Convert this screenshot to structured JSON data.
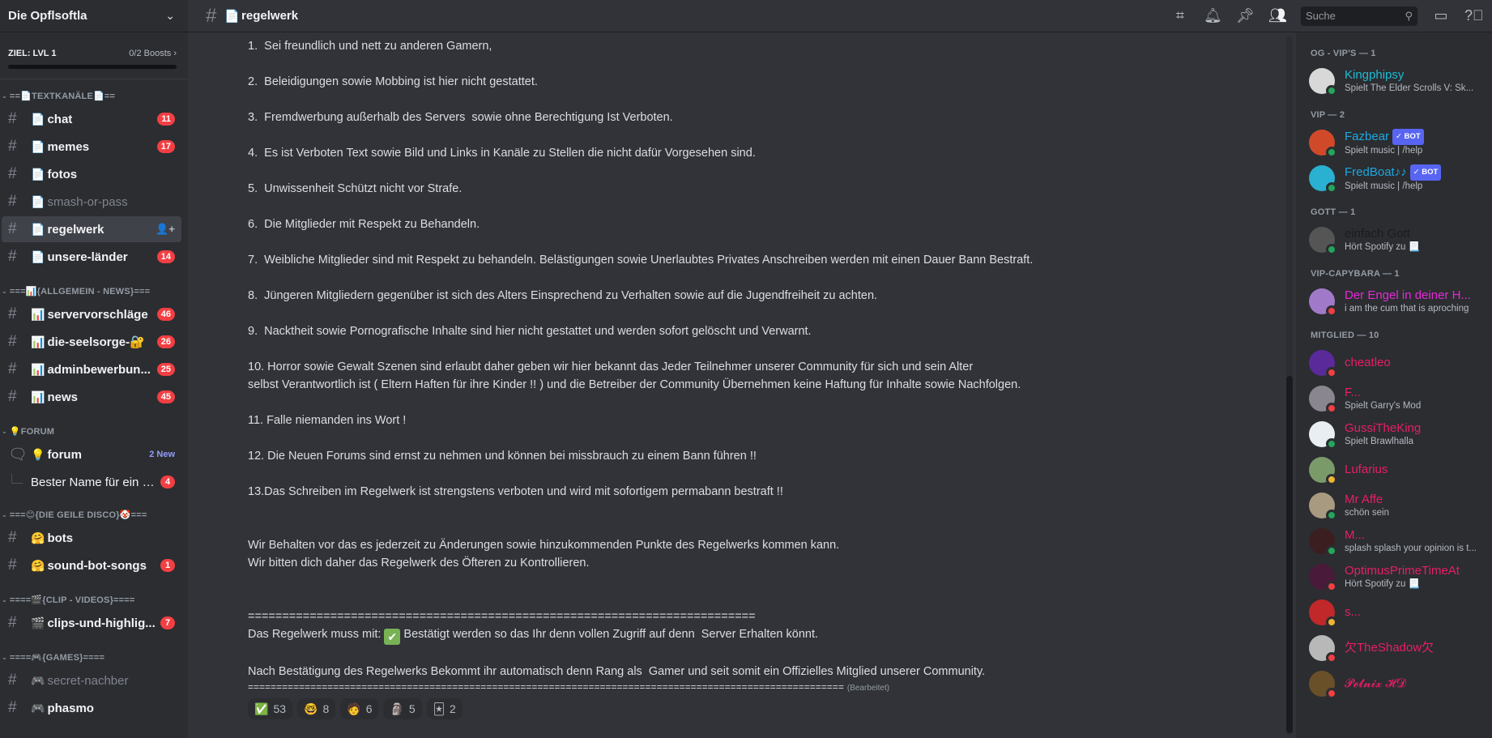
{
  "server": {
    "name": "Die Opflsoftla",
    "boost_goal": "ZIEL: LVL 1",
    "boost_count": "0/2 Boosts",
    "boost_progress": 0
  },
  "sidebar": {
    "categories": [
      {
        "label": "==📄TEXTKANÄLE📄==",
        "channels": [
          {
            "emoji": "📄",
            "name": "chat",
            "badge": "11",
            "muted": false
          },
          {
            "emoji": "📄",
            "name": "memes",
            "badge": "17",
            "muted": false
          },
          {
            "emoji": "📄",
            "name": "fotos",
            "badge": "",
            "muted": false
          },
          {
            "emoji": "📄",
            "name": "smash-or-pass",
            "badge": "",
            "muted": true
          },
          {
            "emoji": "📄",
            "name": "regelwerk",
            "badge": "",
            "muted": false,
            "active": true
          },
          {
            "emoji": "📄",
            "name": "unsere-länder",
            "badge": "14",
            "muted": false
          }
        ]
      },
      {
        "label": "===📊{ALLGEMEIN - NEWS}===",
        "channels": [
          {
            "emoji": "📊",
            "name": "servervorschläge",
            "badge": "46",
            "muted": false
          },
          {
            "emoji": "📊",
            "name": "die-seelsorge-🔐",
            "badge": "26",
            "muted": false
          },
          {
            "emoji": "📊",
            "name": "adminbewerbun...",
            "badge": "25",
            "muted": false
          },
          {
            "emoji": "📊",
            "name": "news",
            "badge": "45",
            "muted": false
          }
        ]
      },
      {
        "label": "💡FORUM",
        "forum": {
          "emoji": "💡",
          "name": "forum",
          "new_label": "2 New"
        },
        "thread": {
          "name": "Bester Name für ein B...",
          "badge": "4"
        }
      },
      {
        "label": "===😊{DIE GEILE DISCO}🤡===",
        "channels": [
          {
            "emoji": "🤗",
            "name": "bots",
            "badge": "",
            "muted": false
          },
          {
            "emoji": "🤗",
            "name": "sound-bot-songs",
            "badge": "1",
            "muted": false
          }
        ]
      },
      {
        "label": "====🎬{CLIP - VIDEOS}====",
        "channels": [
          {
            "emoji": "🎬",
            "name": "clips-und-highlig...",
            "badge": "7",
            "muted": false
          }
        ]
      },
      {
        "label": "====🎮{GAMES}====",
        "channels": [
          {
            "emoji": "🎮",
            "name": "secret-nachber",
            "badge": "",
            "muted": true
          },
          {
            "emoji": "🎮",
            "name": "phasmo",
            "badge": "",
            "muted": false
          }
        ]
      }
    ]
  },
  "header": {
    "channel_emoji": "📄",
    "channel_name": "regelwerk",
    "search_placeholder": "Suche",
    "icons": [
      "threads-icon",
      "bell-icon",
      "pin-icon",
      "members-icon",
      "inbox-icon",
      "help-icon"
    ]
  },
  "message": {
    "lines": [
      "1.  Sei freundlich und nett zu anderen Gamern,",
      "",
      "2.  Beleidigungen sowie Mobbing ist hier nicht gestattet.",
      "",
      "3.  Fremdwerbung außerhalb des Servers  sowie ohne Berechtigung Ist Verboten.",
      "",
      "4.  Es ist Verboten Text sowie Bild und Links in Kanäle zu Stellen die nicht dafür Vorgesehen sind.",
      "",
      "5.  Unwissenheit Schützt nicht vor Strafe.",
      "",
      "6.  Die Mitglieder mit Respekt zu Behandeln.",
      "",
      "7.  Weibliche Mitglieder sind mit Respekt zu behandeln. Belästigungen sowie Unerlaubtes Privates Anschreiben werden mit einen Dauer Bann Bestraft.",
      "",
      "8.  Jüngeren Mitgliedern gegenüber ist sich des Alters Einsprechend zu Verhalten sowie auf die Jugendfreiheit zu achten.",
      "",
      "9.  Nacktheit sowie Pornografische Inhalte sind hier nicht gestattet und werden sofort gelöscht und Verwarnt.",
      "",
      "10. Horror sowie Gewalt Szenen sind erlaubt daher geben wir hier bekannt das Jeder Teilnehmer unserer Community für sich und sein Alter",
      "selbst Verantwortlich ist ( Eltern Haften für ihre Kinder !! ) und die Betreiber der Community Übernehmen keine Haftung für Inhalte sowie Nachfolgen.",
      "",
      "11. Falle niemanden ins Wort !",
      "",
      "12. Die Neuen Forums sind ernst zu nehmen und können bei missbrauch zu einem Bann führen !!",
      "",
      "13.Das Schreiben im Regelwerk ist strengstens verboten und wird mit sofortigem permabann bestraft !!",
      "",
      "",
      "Wir Behalten vor das es jederzeit zu Änderungen sowie hinzukommenden Punkte des Regelwerks kommen kann.",
      "Wir bitten dich daher das Regelwerk des Öfteren zu Kontrollieren.",
      "",
      "",
      "=========================================================================="
    ],
    "confirm_prefix": "Das Regelwerk muss mit: ",
    "confirm_emoji": "✔",
    "confirm_suffix": " Bestätigt werden so das Ihr denn vollen Zugriff auf denn  Server Erhalten könnt.",
    "after_confirm": "Nach Bestätigung des Regelwerks Bekommt ihr automatisch denn Rang als  Gamer und seit somit ein Offizielles Mitglied unserer Community.",
    "final_rule": "=========================================================================================================",
    "edited_label": "(Bearbeitet)",
    "reactions": [
      {
        "emoji": "✅",
        "count": "53"
      },
      {
        "emoji": "🤓",
        "count": "8"
      },
      {
        "emoji": "🧑",
        "count": "6"
      },
      {
        "emoji": "🗿",
        "count": "5"
      },
      {
        "emoji": "🃏",
        "count": "2"
      }
    ]
  },
  "members": {
    "groups": [
      {
        "label": "OG - VIP'S — 1",
        "members": [
          {
            "name": "Kingphipsy",
            "activity": "Spielt The Elder Scrolls V: Sk...",
            "color": "#1abcd4",
            "status": "online",
            "avatar": "#d8d8d8"
          }
        ]
      },
      {
        "label": "VIP — 2",
        "members": [
          {
            "name": "Fazbear",
            "activity": "Spielt music | /help",
            "color": "#1ea8e0",
            "status": "online",
            "bot": "✓ BOT",
            "avatar": "#d04a2a"
          },
          {
            "name": "FredBoat♪♪",
            "activity": "Spielt music | /help",
            "color": "#1ea8e0",
            "status": "online",
            "bot": "✓ BOT",
            "avatar": "#2ab0d0"
          }
        ]
      },
      {
        "label": "GOTT — 1",
        "members": [
          {
            "name": "einfach Gott",
            "activity": "Hört Spotify zu 📃",
            "color": "#1b1c1f",
            "status": "online",
            "avatar": "#555"
          }
        ]
      },
      {
        "label": "VIP-CAPYBARA — 1",
        "members": [
          {
            "name": "Der Engel in deiner H...",
            "activity": "i am the cum that is aproching",
            "color": "#e62ad6",
            "status": "dnd",
            "avatar": "#a07ac8"
          }
        ]
      },
      {
        "label": "MITGLIED — 10",
        "members": [
          {
            "name": "cheatleo",
            "activity": "",
            "color": "#e91e63",
            "status": "dnd",
            "avatar": "#5a2a9a"
          },
          {
            "name": "F...",
            "activity": "Spielt Garry's Mod",
            "color": "#e91e63",
            "status": "dnd",
            "avatar": "#8a8690"
          },
          {
            "name": "GussiTheKing",
            "activity": "Spielt Brawlhalla",
            "color": "#e91e63",
            "status": "online",
            "avatar": "#e8eef2"
          },
          {
            "name": "Lufarius",
            "activity": "",
            "color": "#e91e63",
            "status": "idle",
            "avatar": "#7a9a6a"
          },
          {
            "name": "Mr Affe",
            "activity": "schön sein",
            "color": "#e91e63",
            "status": "online",
            "avatar": "#a89a80"
          },
          {
            "name": "M...",
            "activity": "splash splash your opinion is t...",
            "color": "#e91e63",
            "status": "online",
            "avatar": "#3a1e20"
          },
          {
            "name": "OptimusPrimeTimeAt",
            "activity": "Hört Spotify zu 📃",
            "color": "#e91e63",
            "status": "dnd",
            "avatar": "#4a1a3a"
          },
          {
            "name": "s...",
            "activity": "",
            "color": "#e91e63",
            "status": "idle",
            "avatar": "#c0282a"
          },
          {
            "name": "欠TheShadow欠",
            "activity": "",
            "color": "#e91e63",
            "status": "dnd",
            "avatar": "#b8b8b8"
          },
          {
            "name": "𝓟𝓮𝓽𝓷𝓲𝔁 𝓗𝓓",
            "activity": "",
            "color": "#e91e63",
            "status": "dnd",
            "avatar": "#6a5028"
          }
        ]
      }
    ]
  }
}
